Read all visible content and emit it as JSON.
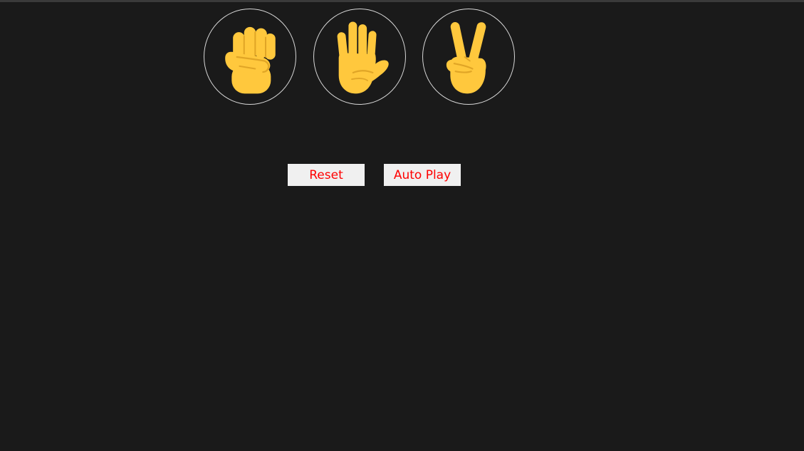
{
  "moves": [
    {
      "id": "rock",
      "icon": "raised-fist-icon"
    },
    {
      "id": "paper",
      "icon": "raised-hand-icon"
    },
    {
      "id": "scissors",
      "icon": "victory-hand-icon"
    }
  ],
  "controls": {
    "reset_label": "Reset",
    "auto_play_label": "Auto Play"
  },
  "colors": {
    "background": "#1a1a1a",
    "skin": "#ffc83d",
    "skin_shade": "#e0a526",
    "button_bg": "#f0f0f0",
    "button_text": "#ff0000",
    "circle_border": "#d8d8d8"
  }
}
